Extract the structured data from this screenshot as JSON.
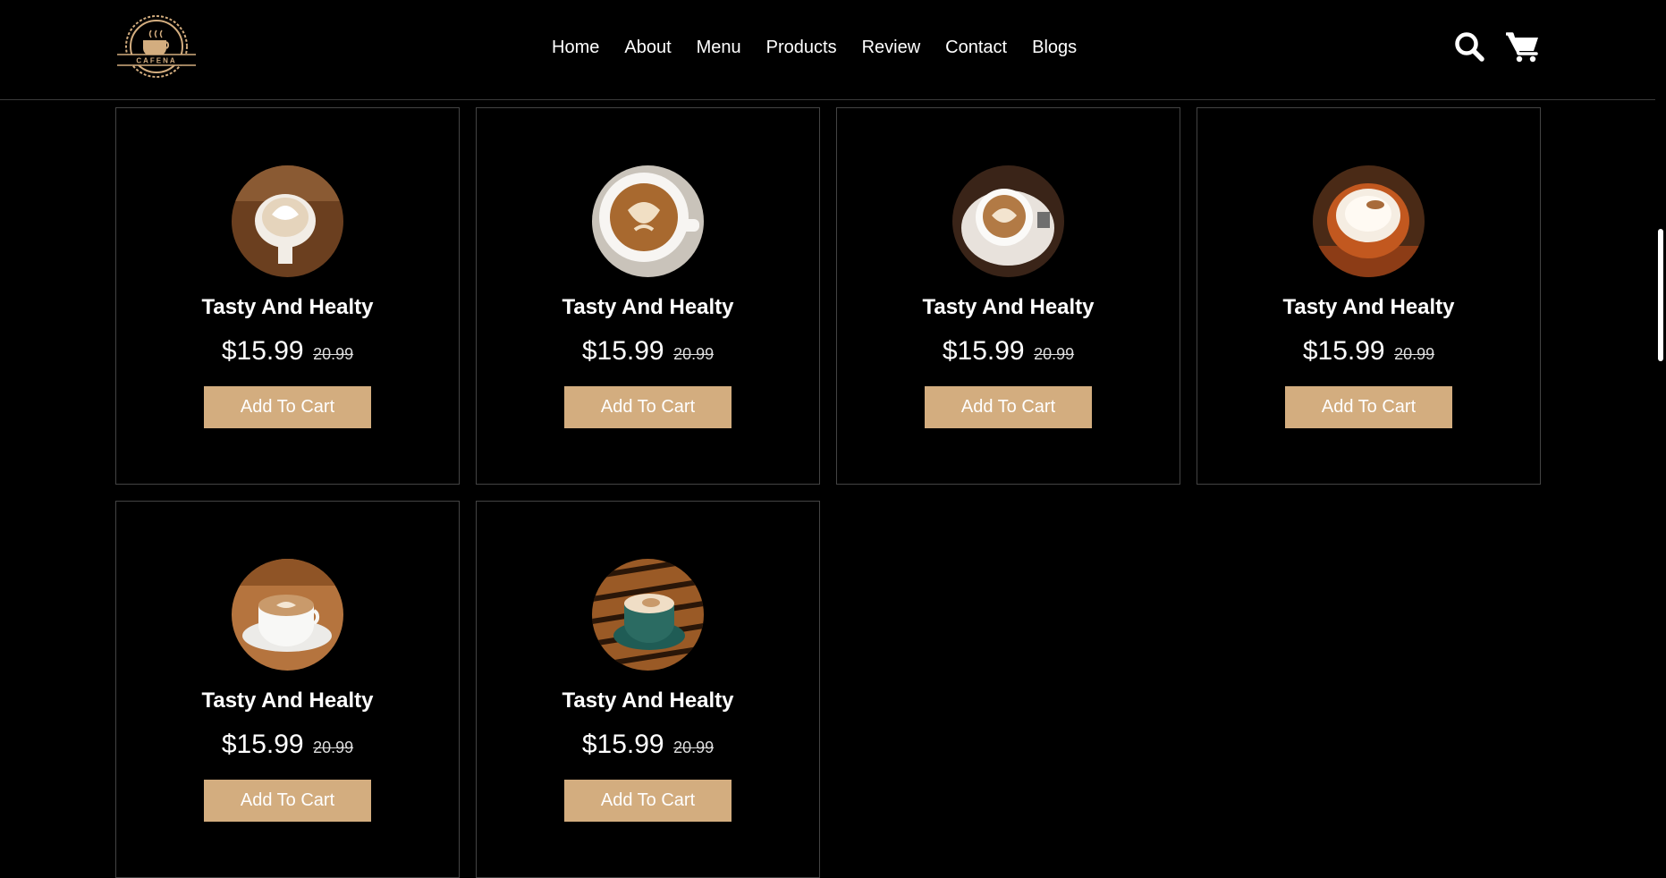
{
  "brand": {
    "name": "CAFENA",
    "accent": "#d3ad7f"
  },
  "nav": {
    "items": [
      {
        "label": "Home"
      },
      {
        "label": "About"
      },
      {
        "label": "Menu"
      },
      {
        "label": "Products"
      },
      {
        "label": "Review"
      },
      {
        "label": "Contact"
      },
      {
        "label": "Blogs"
      }
    ]
  },
  "header_icons": {
    "search": "search-icon",
    "cart": "cart-icon"
  },
  "products": [
    {
      "name": "Tasty And Healty",
      "price": "$15.99",
      "old_price": "20.99",
      "button": "Add To Cart"
    },
    {
      "name": "Tasty And Healty",
      "price": "$15.99",
      "old_price": "20.99",
      "button": "Add To Cart"
    },
    {
      "name": "Tasty And Healty",
      "price": "$15.99",
      "old_price": "20.99",
      "button": "Add To Cart"
    },
    {
      "name": "Tasty And Healty",
      "price": "$15.99",
      "old_price": "20.99",
      "button": "Add To Cart"
    },
    {
      "name": "Tasty And Healty",
      "price": "$15.99",
      "old_price": "20.99",
      "button": "Add To Cart"
    },
    {
      "name": "Tasty And Healty",
      "price": "$15.99",
      "old_price": "20.99",
      "button": "Add To Cart"
    }
  ]
}
